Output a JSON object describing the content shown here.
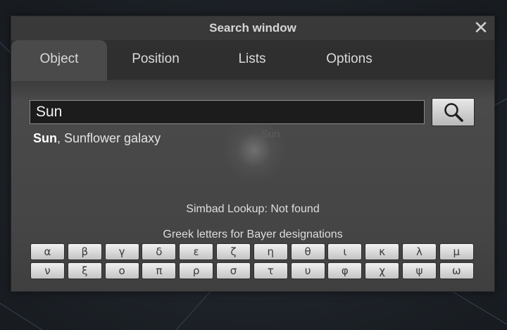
{
  "window": {
    "title": "Search window",
    "close_icon": "close-icon"
  },
  "tabs": [
    {
      "label": "Object",
      "active": true
    },
    {
      "label": "Position",
      "active": false
    },
    {
      "label": "Lists",
      "active": false
    },
    {
      "label": "Options",
      "active": false
    }
  ],
  "search": {
    "value": "Sun",
    "button_icon": "magnifier-icon"
  },
  "suggestions": {
    "primary": "Sun",
    "rest": ", Sunflower galaxy"
  },
  "sky_label": "Sun",
  "simbad_status": "Simbad Lookup: Not found",
  "greek": {
    "label": "Greek letters for Bayer designations",
    "letters": [
      "α",
      "β",
      "γ",
      "δ",
      "ε",
      "ζ",
      "η",
      "θ",
      "ι",
      "κ",
      "λ",
      "μ",
      "ν",
      "ξ",
      "ο",
      "π",
      "ρ",
      "σ",
      "τ",
      "υ",
      "φ",
      "χ",
      "ψ",
      "ω"
    ]
  }
}
